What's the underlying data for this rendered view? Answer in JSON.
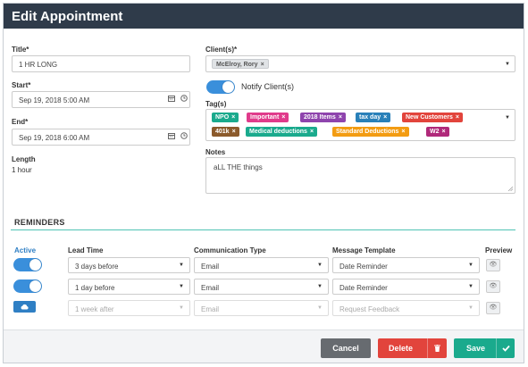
{
  "header": {
    "title": "Edit Appointment"
  },
  "form": {
    "title_label": "Title*",
    "title_value": "1 HR LONG",
    "start_label": "Start*",
    "start_value": "Sep 19, 2018 5:00 AM",
    "end_label": "End*",
    "end_value": "Sep 19, 2018 6:00 AM",
    "length_label": "Length",
    "length_value": "1 hour",
    "clients_label": "Client(s)*",
    "client_chip": "McElroy, Rory",
    "notify_label": "Notify Client(s)",
    "notify_on": true,
    "tags_label": "Tag(s)",
    "tags": [
      {
        "label": "NPO",
        "color": "#1aaa8d"
      },
      {
        "label": "Important",
        "color": "#e03b8b"
      },
      {
        "label": "2018 Items",
        "color": "#8e44ad"
      },
      {
        "label": "tax day",
        "color": "#2980b9"
      },
      {
        "label": "New Customers",
        "color": "#e2443c"
      },
      {
        "label": "401k",
        "color": "#8b5a2b"
      },
      {
        "label": "Medical deductions",
        "color": "#1aaa8d"
      },
      {
        "label": "Standard Deductions",
        "color": "#f39c12"
      },
      {
        "label": "W2",
        "color": "#b0297a"
      }
    ],
    "notes_label": "Notes",
    "notes_value": "aLL THE things"
  },
  "reminders": {
    "title": "REMINDERS",
    "headers": {
      "active": "Active",
      "lead_time": "Lead Time",
      "communication": "Communication Type",
      "template": "Message Template",
      "preview": "Preview"
    },
    "rows": [
      {
        "active": true,
        "lead_time": "3 days before",
        "communication": "Email",
        "template": "Date Reminder",
        "disabled": false
      },
      {
        "active": true,
        "lead_time": "1 day before",
        "communication": "Email",
        "template": "Date Reminder",
        "disabled": false
      },
      {
        "active": false,
        "lead_time": "1 week after",
        "communication": "Email",
        "template": "Request Feedback",
        "disabled": true
      }
    ]
  },
  "footer": {
    "cancel_label": "Cancel",
    "delete_label": "Delete",
    "save_label": "Save"
  },
  "icons": {
    "calendar": "calendar-icon",
    "clock": "clock-icon",
    "eye": "eye-icon",
    "trash": "trash-icon",
    "check": "check-icon"
  }
}
